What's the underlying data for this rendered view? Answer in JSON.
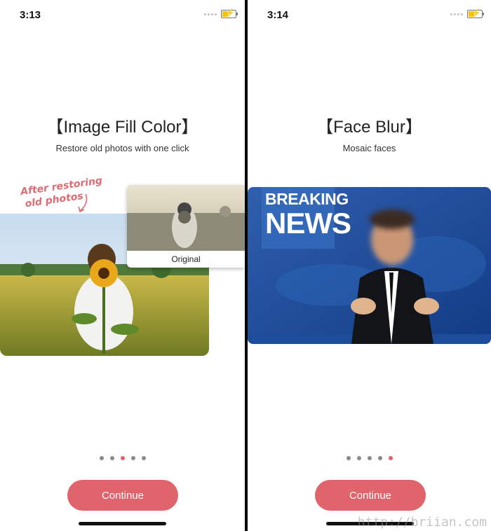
{
  "screens": [
    {
      "status": {
        "time": "3:13"
      },
      "title": "【Image Fill Color】",
      "subtitle": "Restore old photos with one click",
      "annotation": "After restoring old photos",
      "annotation_line1": "After restoring",
      "annotation_line2": "old photos",
      "original_caption": "Original",
      "page_indicator": {
        "total": 5,
        "active": 3
      },
      "continue_label": "Continue"
    },
    {
      "status": {
        "time": "3:14"
      },
      "title": "【Face Blur】",
      "subtitle": "Mosaic faces",
      "news_line1": "BREAKING",
      "news_line2": "NEWS",
      "page_indicator": {
        "total": 5,
        "active": 5
      },
      "continue_label": "Continue"
    }
  ],
  "watermark": "http://briian.com",
  "colors": {
    "accent": "#e0646b",
    "dot_inactive": "#8a8a8a"
  }
}
